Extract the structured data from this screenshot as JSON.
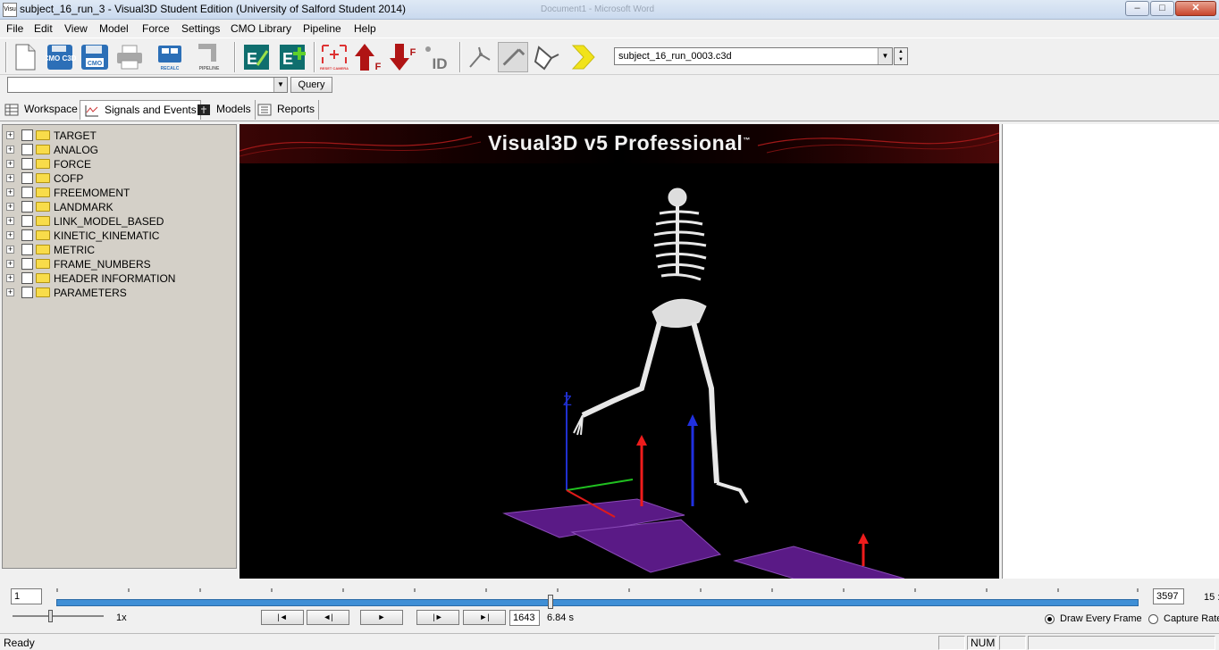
{
  "window": {
    "title": "subject_16_run_3 - Visual3D Student Edition (University of Salford Student 2014)",
    "background_title": "Document1 - Microsoft Word",
    "app_icon_text": "Visu",
    "minimize": "–",
    "maximize": "□",
    "close": "✕"
  },
  "menu": [
    "File",
    "Edit",
    "View",
    "Model",
    "Force",
    "Settings",
    "CMO Library",
    "Pipeline",
    "Help"
  ],
  "toolbar": {
    "buttons": [
      {
        "name": "new-file-icon",
        "label": ""
      },
      {
        "name": "cmo-c3d-icon",
        "label": "CMO C3D"
      },
      {
        "name": "save-cmo-icon",
        "label": "CMO"
      },
      {
        "name": "print-icon",
        "label": ""
      },
      {
        "name": "recalc-icon",
        "label": "RECALC"
      },
      {
        "name": "pipeline-icon",
        "label": "PIPELINE"
      },
      {
        "name": "edit-pipeline-icon",
        "label": "E"
      },
      {
        "name": "add-pipeline-icon",
        "label": "E"
      },
      {
        "name": "reset-camera-icon",
        "label": "RESET CAMERA"
      },
      {
        "name": "force-up-icon",
        "label": "F"
      },
      {
        "name": "force-down-icon",
        "label": "F"
      },
      {
        "name": "id-icon",
        "label": "ID"
      }
    ],
    "file_combo_value": "subject_16_run_0003.c3d"
  },
  "query": {
    "input_value": "",
    "button_label": "Query"
  },
  "tabs": [
    "Workspace",
    "Signals and Events",
    "Models",
    "Reports"
  ],
  "active_tab": "Signals and Events",
  "tree": [
    "TARGET",
    "ANALOG",
    "FORCE",
    "COFP",
    "FREEMOMENT",
    "LANDMARK",
    "LINK_MODEL_BASED",
    "KINETIC_KINEMATIC",
    "METRIC",
    "FRAME_NUMBERS",
    "HEADER INFORMATION",
    "PARAMETERS"
  ],
  "viewport": {
    "banner_title": "Visual3D v5 Professional",
    "trademark": "™"
  },
  "timeline": {
    "start_frame": "1",
    "end_frame": "3597",
    "fps_label": "15 :",
    "speed_label": "1x",
    "current_frame": "1643",
    "current_time": "6.84 s",
    "position_fraction": 0.457
  },
  "playback": {
    "first": "|◄",
    "step_back": "◄|",
    "play": "►",
    "step_forward": "|►",
    "last": "►|"
  },
  "options": {
    "draw_every_frame": "Draw Every Frame",
    "capture_rate": "Capture Rate",
    "selected": "draw_every_frame"
  },
  "status": {
    "text": "Ready",
    "num": "NUM"
  },
  "colors": {
    "timeline": "#3f8fd6",
    "force_vector": "#ee1c1c",
    "plate": "#5a1a86",
    "banner": "#3a0505"
  }
}
